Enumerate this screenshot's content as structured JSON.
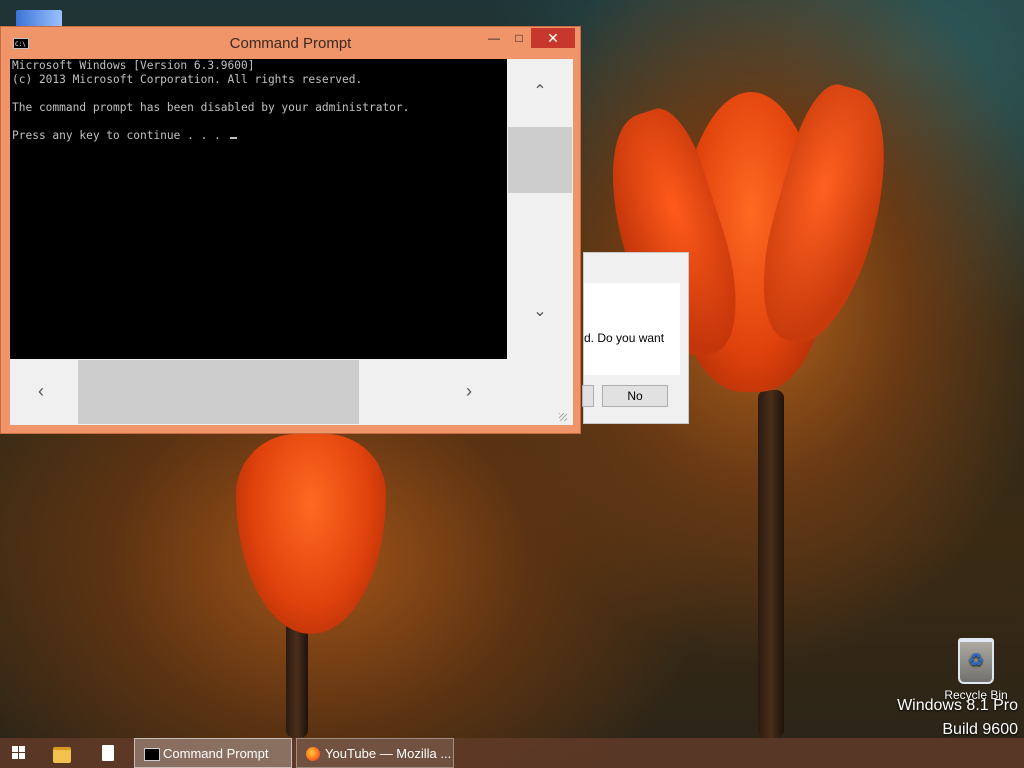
{
  "cmd": {
    "title": "Command Prompt",
    "controls": {
      "minimize": "—",
      "maximize": "□",
      "close": "✕"
    },
    "console_lines": [
      "Microsoft Windows [Version 6.3.9600]",
      "(c) 2013 Microsoft Corporation. All rights reserved.",
      "",
      "The command prompt has been disabled by your administrator.",
      "",
      "Press any key to continue . . . "
    ]
  },
  "dialog": {
    "message": "d. Do you want",
    "no_button": "No"
  },
  "desktop": {
    "recycle_bin_label": "Recycle Bin",
    "watermark": [
      "Windows 8.1 Pro",
      "Build 9600"
    ]
  },
  "taskbar": {
    "tasks": [
      {
        "label": "Command Prompt",
        "icon": "cmd-icon"
      },
      {
        "label": "YouTube — Mozilla ...",
        "icon": "firefox-icon"
      }
    ]
  },
  "icons": {
    "start": "windows-logo-icon",
    "explorer": "folder-icon",
    "notepad": "document-icon"
  },
  "colors": {
    "cmd_frame": "#f0946a",
    "close_button": "#c7382c",
    "taskbar": "#603a28"
  }
}
